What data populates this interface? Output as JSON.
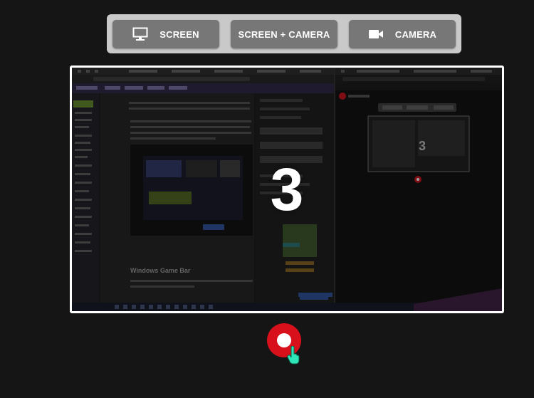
{
  "modes": {
    "screen_label": "SCREEN",
    "screen_camera_label": "SCREEN + CAMERA",
    "camera_label": "CAMERA"
  },
  "preview": {
    "countdown": "3",
    "embedded_heading": "Windows Game Bar"
  },
  "colors": {
    "page_bg": "#151515",
    "mode_bar_bg": "#c9c9c9",
    "mode_button_bg": "#777777",
    "record_red": "#d8101c",
    "cursor_teal": "#2ee6b8"
  },
  "icons": {
    "screen": "monitor-icon",
    "camera": "video-camera-icon",
    "record": "record-dot-icon",
    "cursor": "hand-pointer-icon"
  }
}
